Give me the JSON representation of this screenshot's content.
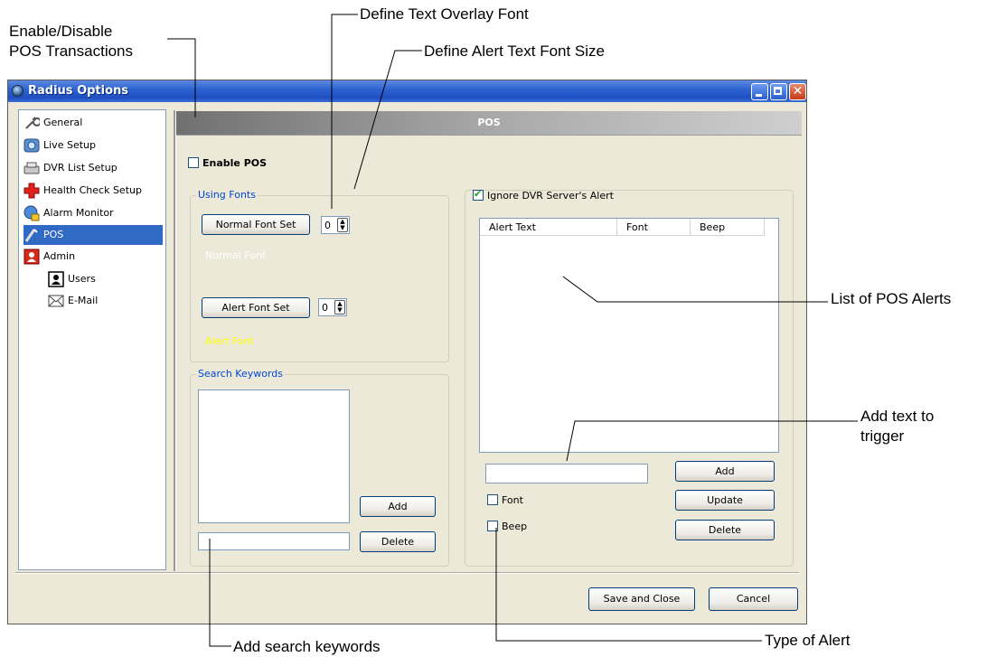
{
  "annotations": {
    "enable_disable": "Enable/Disable",
    "pos_transactions": "POS Transactions",
    "define_overlay_font": "Define Text Overlay Font",
    "define_alert_size": "Define Alert Text Font Size",
    "list_alerts": "List of POS Alerts",
    "add_text_1": "Add text to",
    "add_text_2": "trigger",
    "add_keywords": "Add search keywords",
    "type_alert": "Type of Alert"
  },
  "window": {
    "title": "Radius Options",
    "close_glyph": "✕"
  },
  "sidebar": {
    "items": [
      {
        "label": "General",
        "icon": "wrench-icon"
      },
      {
        "label": "Live Setup",
        "icon": "live-camera-icon"
      },
      {
        "label": "DVR List Setup",
        "icon": "dvr-device-icon"
      },
      {
        "label": "Health Check Setup",
        "icon": "health-cross-icon"
      },
      {
        "label": "Alarm Monitor",
        "icon": "alarm-globe-icon"
      },
      {
        "label": "POS",
        "icon": "pos-wand-icon",
        "selected": true
      },
      {
        "label": "Admin",
        "icon": "admin-user-icon"
      },
      {
        "label": "Users",
        "icon": "user-icon"
      },
      {
        "label": "E-Mail",
        "icon": "envelope-icon"
      }
    ]
  },
  "content": {
    "header": "POS",
    "enable_pos": {
      "label": "Enable POS",
      "checked": false
    },
    "using_fonts": {
      "title": "Using Fonts",
      "normal_button": "Normal Font Set",
      "normal_size": "0",
      "normal_preview": "Normal Font",
      "alert_button": "Alert Font Set",
      "alert_size": "0",
      "alert_preview": "Alert Font"
    },
    "search_keywords": {
      "title": "Search Keywords",
      "add_button": "Add",
      "delete_button": "Delete",
      "input_value": ""
    },
    "alerts": {
      "ignore_label": "Ignore DVR Server's Alert",
      "ignore_checked": true,
      "columns": [
        "Alert Text",
        "Font",
        "Beep"
      ],
      "rows": [],
      "input_value": "",
      "font_label": "Font",
      "beep_label": "Beep",
      "add_button": "Add",
      "update_button": "Update",
      "delete_button": "Delete"
    },
    "footer": {
      "save_button": "Save and Close",
      "cancel_button": "Cancel"
    }
  },
  "colors": {
    "normal_preview": "#ffffff",
    "alert_preview": "#ffff00",
    "selection": "#316ac5",
    "titlebar": "#2d63d1"
  }
}
